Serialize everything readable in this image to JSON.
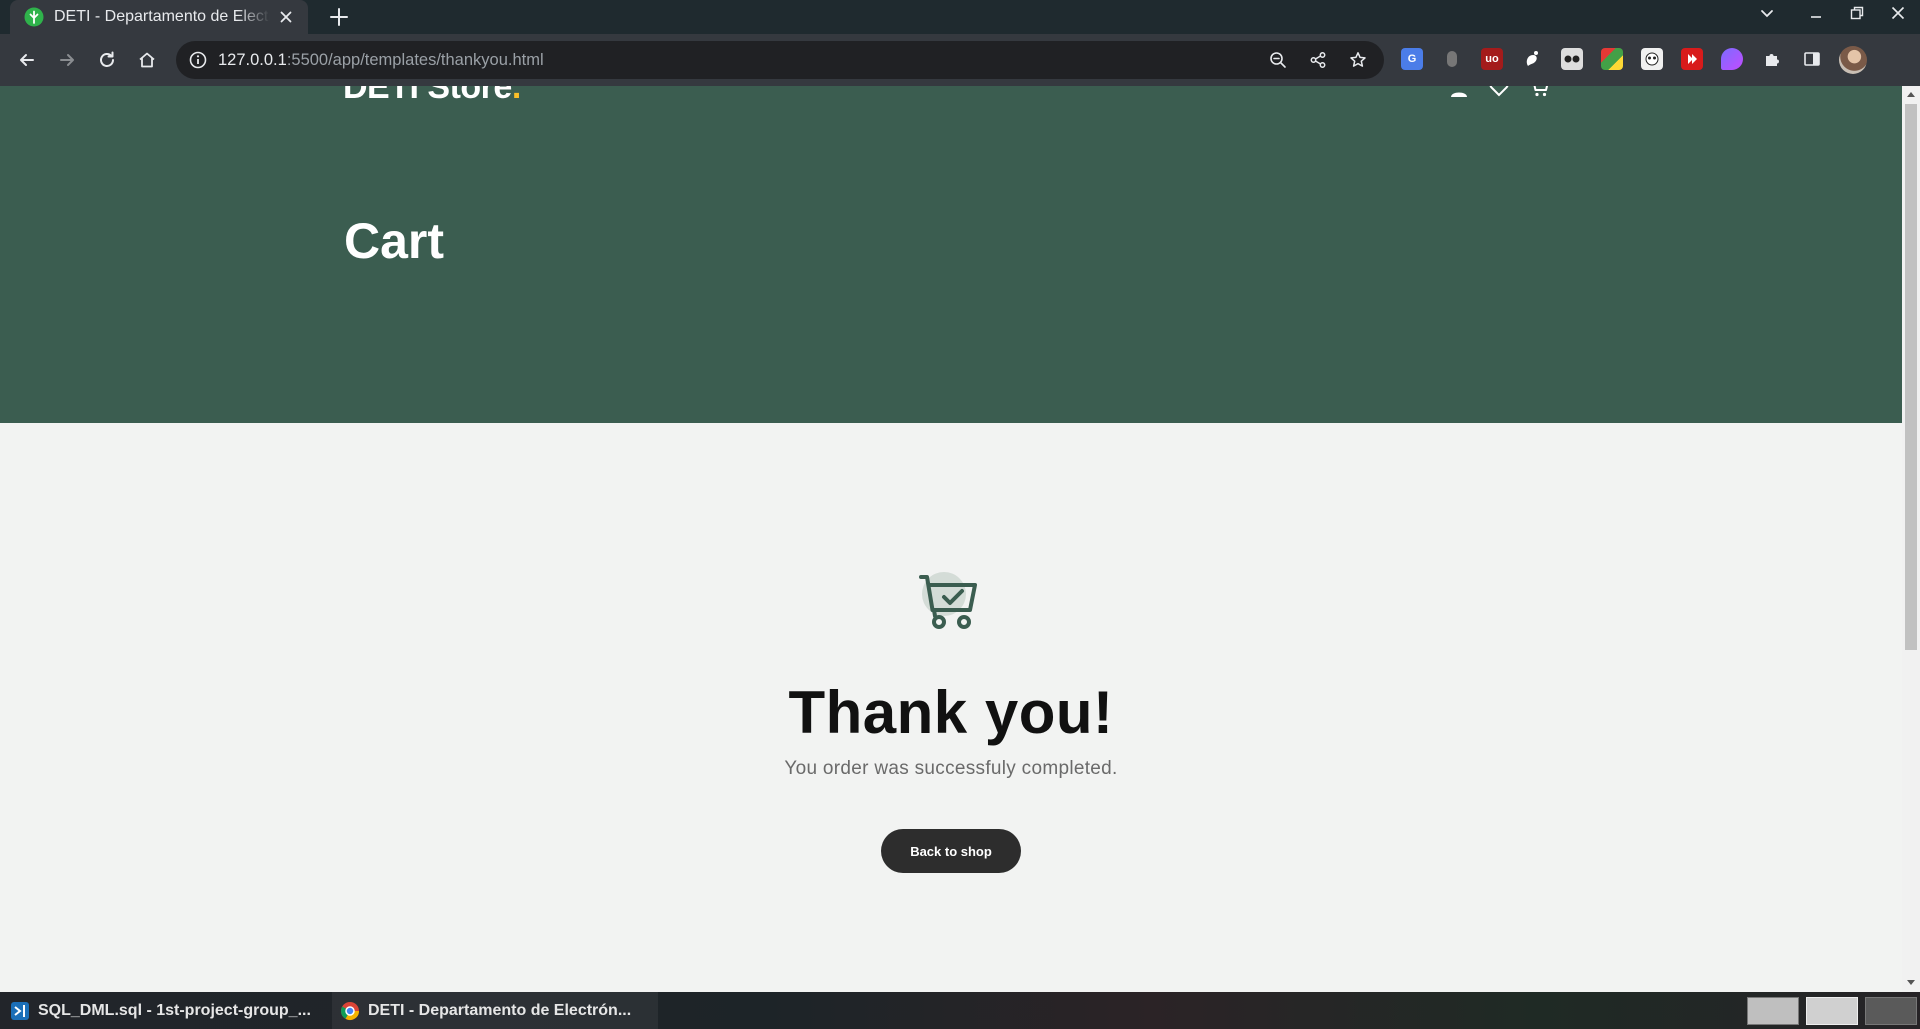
{
  "browser": {
    "tab": {
      "title": "DETI - Departamento de Electrónica, Telecomunicações e Informática"
    },
    "address_bar": {
      "host": "127.0.0.1",
      "path": ":5500/app/templates/thankyou.html"
    },
    "extensions": [
      "google-translate",
      "mouse-extension",
      "ublock-origin",
      "gnome-extension",
      "reader-extension",
      "colorful-extension",
      "panda-extension",
      "flash-extension",
      "purple-extension",
      "puzzle-extension"
    ]
  },
  "page": {
    "logo": {
      "text": "DETI Store",
      "dot": "."
    },
    "hero_title": "Cart",
    "thankyou": {
      "title": "Thank you!",
      "message": "You order was successfuly completed.",
      "button": "Back to shop"
    },
    "colors": {
      "hero": "#3b5d50",
      "accent": "#f9bf29",
      "button": "#2d2d2d",
      "background": "#f2f3f2"
    }
  },
  "taskbar": {
    "items": [
      {
        "label": "SQL_DML.sql - 1st-project-group_..."
      },
      {
        "label": "DETI - Departamento de Electrón..."
      }
    ]
  }
}
